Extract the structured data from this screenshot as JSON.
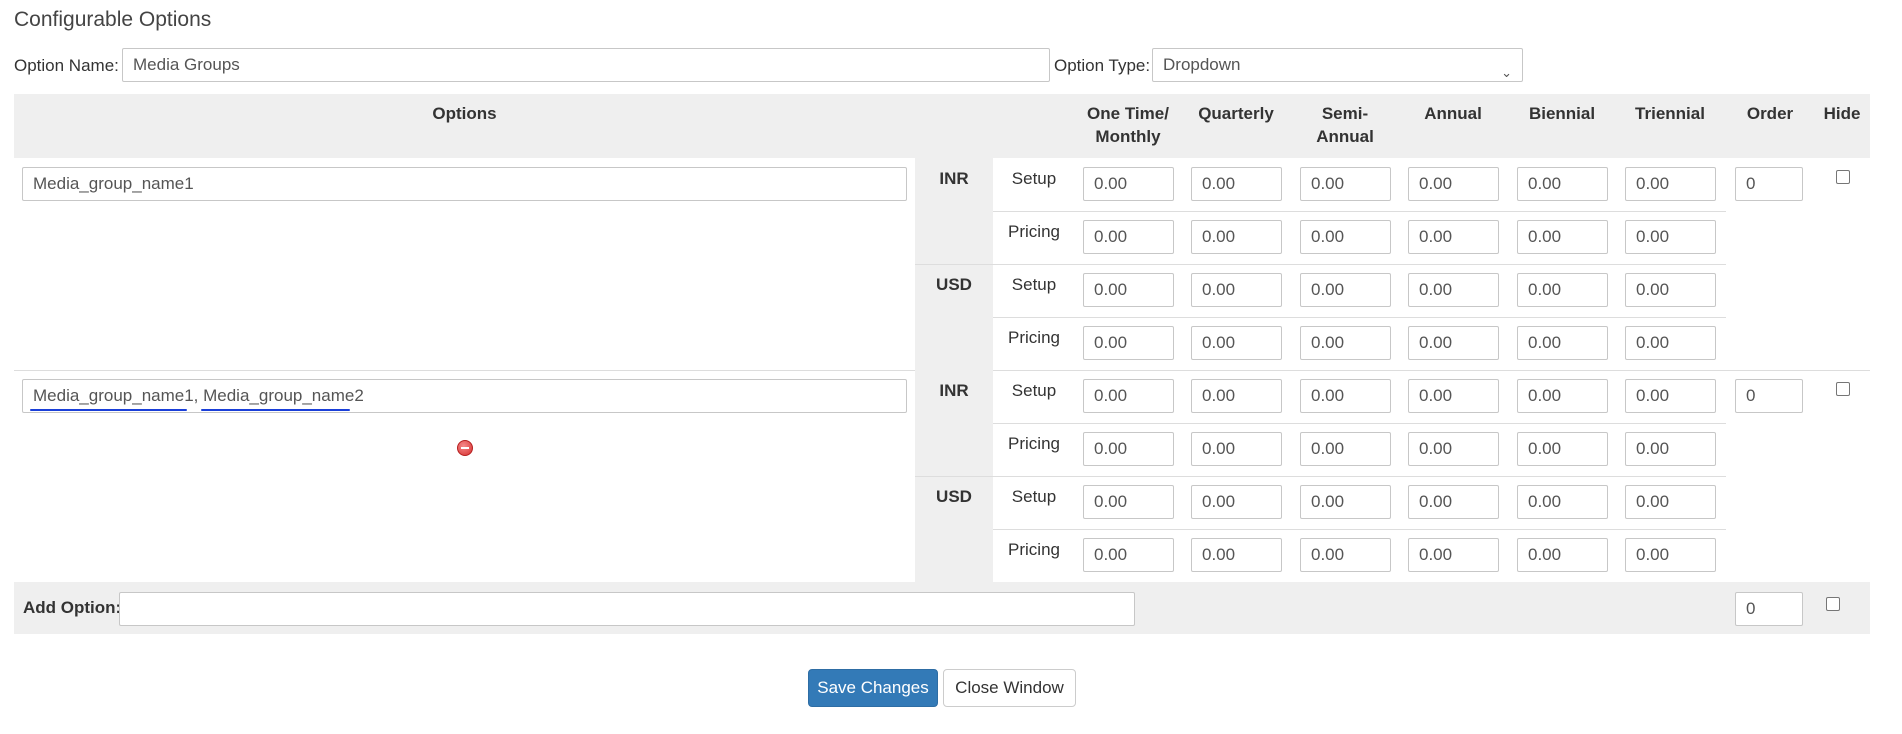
{
  "header": {
    "title": "Configurable Options"
  },
  "option": {
    "name_label": "Option Name:",
    "name_value": "Media Groups",
    "type_label": "Option Type:",
    "type_value": "Dropdown"
  },
  "table": {
    "columns": {
      "options": "Options",
      "one_time_monthly": "One Time/ Monthly",
      "quarterly": "Quarterly",
      "semi_annual": "Semi- Annual",
      "annual": "Annual",
      "biennial": "Biennial",
      "triennial": "Triennial",
      "order": "Order",
      "hide": "Hide"
    },
    "row_labels": {
      "setup": "Setup",
      "pricing": "Pricing"
    },
    "options": [
      {
        "name": "Media_group_name1",
        "order": "0",
        "hidden": false,
        "currencies": [
          {
            "code": "INR",
            "setup": [
              "0.00",
              "0.00",
              "0.00",
              "0.00",
              "0.00",
              "0.00"
            ],
            "pricing": [
              "0.00",
              "0.00",
              "0.00",
              "0.00",
              "0.00",
              "0.00"
            ]
          },
          {
            "code": "USD",
            "setup": [
              "0.00",
              "0.00",
              "0.00",
              "0.00",
              "0.00",
              "0.00"
            ],
            "pricing": [
              "0.00",
              "0.00",
              "0.00",
              "0.00",
              "0.00",
              "0.00"
            ]
          }
        ]
      },
      {
        "name": "Media_group_name1, Media_group_name2",
        "order": "0",
        "hidden": false,
        "currencies": [
          {
            "code": "INR",
            "setup": [
              "0.00",
              "0.00",
              "0.00",
              "0.00",
              "0.00",
              "0.00"
            ],
            "pricing": [
              "0.00",
              "0.00",
              "0.00",
              "0.00",
              "0.00",
              "0.00"
            ]
          },
          {
            "code": "USD",
            "setup": [
              "0.00",
              "0.00",
              "0.00",
              "0.00",
              "0.00",
              "0.00"
            ],
            "pricing": [
              "0.00",
              "0.00",
              "0.00",
              "0.00",
              "0.00",
              "0.00"
            ]
          }
        ]
      }
    ]
  },
  "add_option": {
    "label": "Add Option:",
    "value": "",
    "order": "0"
  },
  "footer": {
    "save_label": "Save Changes",
    "close_label": "Close Window"
  },
  "colors": {
    "primary_button": "#337ab7",
    "header_bg": "#efefef",
    "spellcheck_underline": "#1a3fd9"
  },
  "icons": {
    "remove": "remove-option-icon"
  }
}
